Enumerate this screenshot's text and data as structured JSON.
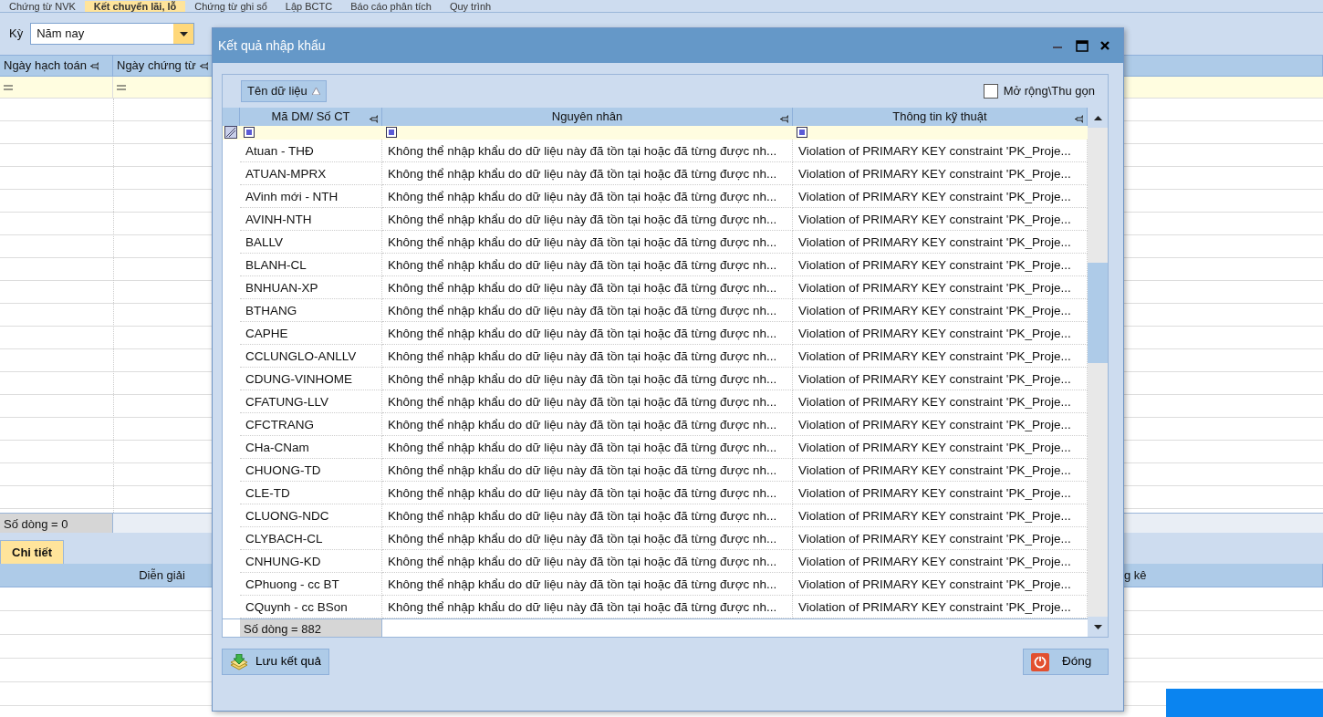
{
  "app_tabs": [
    {
      "label": "Chứng từ NVK",
      "selected": false
    },
    {
      "label": "Kết chuyển lãi, lỗ",
      "selected": true
    },
    {
      "label": "Chứng từ ghi sổ",
      "selected": false
    },
    {
      "label": "Lập BCTC",
      "selected": false
    },
    {
      "label": "Báo cáo phân tích",
      "selected": false
    },
    {
      "label": "Quy trình",
      "selected": false
    }
  ],
  "period": {
    "label": "Kỳ",
    "value": "Năm nay"
  },
  "main_grid": {
    "columns": [
      "Ngày hạch toán",
      "Ngày chứng từ"
    ],
    "footer": "Số dòng = 0"
  },
  "detail_tabs": [
    {
      "label": "Chi tiết",
      "selected": true
    }
  ],
  "detail_grid": {
    "columns": [
      "Diễn giải",
      "g kê"
    ]
  },
  "dialog": {
    "title": "Kết quả nhập khẩu",
    "group_by": "Tên dữ liệu",
    "expand": {
      "label": "Mở rộng\\Thu gọn",
      "checked": false
    },
    "columns": [
      "Mã DM/ Số CT",
      "Nguyên nhân",
      "Thông tin kỹ thuật"
    ],
    "rows": [
      {
        "code": "Atuan - THĐ",
        "reason": "Không thể nhập khẩu do dữ liệu này đã tồn tại hoặc đã từng được nh...",
        "technical": "Violation of PRIMARY KEY constraint 'PK_Proje..."
      },
      {
        "code": "ATUAN-MPRX",
        "reason": "Không thể nhập khẩu do dữ liệu này đã tồn tại hoặc đã từng được nh...",
        "technical": "Violation of PRIMARY KEY constraint 'PK_Proje..."
      },
      {
        "code": "AVinh mới - NTH",
        "reason": "Không thể nhập khẩu do dữ liệu này đã tồn tại hoặc đã từng được nh...",
        "technical": "Violation of PRIMARY KEY constraint 'PK_Proje..."
      },
      {
        "code": "AVINH-NTH",
        "reason": "Không thể nhập khẩu do dữ liệu này đã tồn tại hoặc đã từng được nh...",
        "technical": "Violation of PRIMARY KEY constraint 'PK_Proje..."
      },
      {
        "code": "BALLV",
        "reason": "Không thể nhập khẩu do dữ liệu này đã tồn tại hoặc đã từng được nh...",
        "technical": "Violation of PRIMARY KEY constraint 'PK_Proje..."
      },
      {
        "code": "BLANH-CL",
        "reason": "Không thể nhập khẩu do dữ liệu này đã tồn tại hoặc đã từng được nh...",
        "technical": "Violation of PRIMARY KEY constraint 'PK_Proje..."
      },
      {
        "code": "BNHUAN-XP",
        "reason": "Không thể nhập khẩu do dữ liệu này đã tồn tại hoặc đã từng được nh...",
        "technical": "Violation of PRIMARY KEY constraint 'PK_Proje..."
      },
      {
        "code": "BTHANG",
        "reason": "Không thể nhập khẩu do dữ liệu này đã tồn tại hoặc đã từng được nh...",
        "technical": "Violation of PRIMARY KEY constraint 'PK_Proje..."
      },
      {
        "code": "CAPHE",
        "reason": "Không thể nhập khẩu do dữ liệu này đã tồn tại hoặc đã từng được nh...",
        "technical": "Violation of PRIMARY KEY constraint 'PK_Proje..."
      },
      {
        "code": "CCLUNGLO-ANLLV",
        "reason": "Không thể nhập khẩu do dữ liệu này đã tồn tại hoặc đã từng được nh...",
        "technical": "Violation of PRIMARY KEY constraint 'PK_Proje..."
      },
      {
        "code": "CDUNG-VINHOME",
        "reason": "Không thể nhập khẩu do dữ liệu này đã tồn tại hoặc đã từng được nh...",
        "technical": "Violation of PRIMARY KEY constraint 'PK_Proje..."
      },
      {
        "code": "CFATUNG-LLV",
        "reason": "Không thể nhập khẩu do dữ liệu này đã tồn tại hoặc đã từng được nh...",
        "technical": "Violation of PRIMARY KEY constraint 'PK_Proje..."
      },
      {
        "code": "CFCTRANG",
        "reason": "Không thể nhập khẩu do dữ liệu này đã tồn tại hoặc đã từng được nh...",
        "technical": "Violation of PRIMARY KEY constraint 'PK_Proje..."
      },
      {
        "code": "CHa-CNam",
        "reason": "Không thể nhập khẩu do dữ liệu này đã tồn tại hoặc đã từng được nh...",
        "technical": "Violation of PRIMARY KEY constraint 'PK_Proje..."
      },
      {
        "code": "CHUONG-TD",
        "reason": "Không thể nhập khẩu do dữ liệu này đã tồn tại hoặc đã từng được nh...",
        "technical": "Violation of PRIMARY KEY constraint 'PK_Proje..."
      },
      {
        "code": "CLE-TD",
        "reason": "Không thể nhập khẩu do dữ liệu này đã tồn tại hoặc đã từng được nh...",
        "technical": "Violation of PRIMARY KEY constraint 'PK_Proje..."
      },
      {
        "code": "CLUONG-NDC",
        "reason": "Không thể nhập khẩu do dữ liệu này đã tồn tại hoặc đã từng được nh...",
        "technical": "Violation of PRIMARY KEY constraint 'PK_Proje..."
      },
      {
        "code": "CLYBACH-CL",
        "reason": "Không thể nhập khẩu do dữ liệu này đã tồn tại hoặc đã từng được nh...",
        "technical": "Violation of PRIMARY KEY constraint 'PK_Proje..."
      },
      {
        "code": "CNHUNG-KD",
        "reason": "Không thể nhập khẩu do dữ liệu này đã tồn tại hoặc đã từng được nh...",
        "technical": "Violation of PRIMARY KEY constraint 'PK_Proje..."
      },
      {
        "code": "CPhuong - cc BT",
        "reason": "Không thể nhập khẩu do dữ liệu này đã tồn tại hoặc đã từng được nh...",
        "technical": "Violation of PRIMARY KEY constraint 'PK_Proje..."
      },
      {
        "code": "CQuynh - cc BSon",
        "reason": "Không thể nhập khẩu do dữ liệu này đã tồn tại hoặc đã từng được nh...",
        "technical": "Violation of PRIMARY KEY constraint 'PK_Proje..."
      }
    ],
    "footer": "Số dòng = 882",
    "buttons": [
      {
        "label": "Lưu kết quả",
        "kind": "save"
      },
      {
        "label": "Đóng",
        "kind": "close"
      }
    ]
  }
}
